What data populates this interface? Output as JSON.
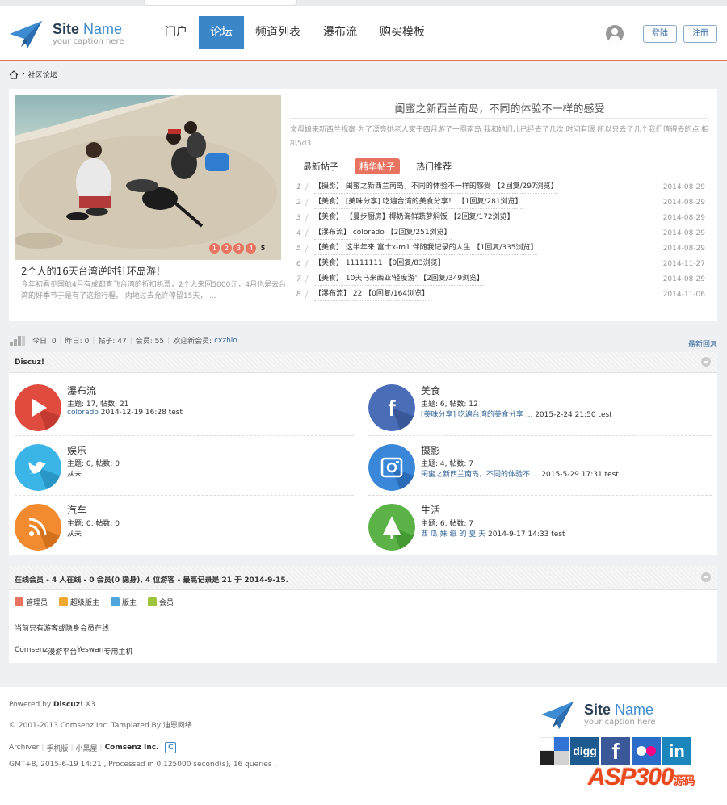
{
  "header": {
    "logo_title_a": "Site",
    "logo_title_b": " Name",
    "logo_caption": "your caption here",
    "nav": [
      "门户",
      "论坛",
      "频道列表",
      "瀑布流",
      "购买模板"
    ],
    "active_nav": "论坛",
    "login_label": "登陆",
    "register_label": "注册"
  },
  "breadcrumb": {
    "label": "社区论坛"
  },
  "feature": {
    "slide_title": "2个人的16天台湾逆时针环岛游！",
    "slide_desc": "今年初看见国航4月有成都直飞台湾的折扣机票，2个人来回5000元，4月也是去台湾的好季节于是有了这趟行程。 内地过去允许停留15天， ...",
    "slide_dots": [
      "1",
      "2",
      "3",
      "4",
      "5"
    ],
    "article_title": "闺蜜之新西兰南岛，不同的体验不一样的感受",
    "article_desc": "文母娘来新西兰视察 为了漂亮她老人家于四月游了一圈南岛 我和她们儿已经去了几次 时间有限 所以只去了几个我们值得去的点 相机5d3 ...",
    "tabs": [
      "最新帖子",
      "精华帖子",
      "热门推荐"
    ],
    "active_tab": "精华帖子",
    "posts": [
      {
        "num": "1",
        "text": "【摄影】 闺蜜之新西兰南岛，不同的体验不一样的感受 【2回复/297浏览】",
        "date": "2014-08-29"
      },
      {
        "num": "2",
        "text": "【美食】 [美味分享] 吃遍台湾的美食分享！ 【1回复/281浏览】",
        "date": "2014-08-29"
      },
      {
        "num": "3",
        "text": "【美食】 【曼步厨房】椰奶海鲜蔬萝焖饭 【2回复/172浏览】",
        "date": "2014-08-29"
      },
      {
        "num": "4",
        "text": "【瀑布流】 colorado 【2回复/251浏览】",
        "date": "2014-08-29"
      },
      {
        "num": "5",
        "text": "【美食】 这半年来 富士x-m1 伴随我记录的人生 【1回复/335浏览】",
        "date": "2014-08-29"
      },
      {
        "num": "6",
        "text": "【美食】 11111111 【0回复/83浏览】",
        "date": "2014-11-27"
      },
      {
        "num": "7",
        "text": "【美食】 10天马来西亚'轻度游' 【2回复/349浏览】",
        "date": "2014-08-29"
      },
      {
        "num": "8",
        "text": "【瀑布流】 22 【0回复/164浏览】",
        "date": "2014-11-06"
      }
    ]
  },
  "stats": {
    "today": "今日: 0",
    "yesterday": "昨日: 0",
    "posts": "帖子: 47",
    "members": "会员: 55",
    "welcome": "欢迎新会员:",
    "new_member": "cxzhio",
    "new_reply": "最新回复"
  },
  "forum_group": {
    "title": "Discuz!",
    "forums": [
      {
        "name": "瀑布流",
        "counts": "主题: 17, 帖数: 21",
        "last_link": "colorado",
        "last_rest": " 2014-12-19 16:28 test",
        "icon": "play-icon",
        "color": "#e04b3f"
      },
      {
        "name": "美食",
        "counts": "主题: 6, 帖数: 12",
        "last_link": "[美味分享] 吃遍台湾的美食分享 ...",
        "last_rest": " 2015-2-24 21:50 test",
        "icon": "facebook-icon",
        "color": "#4a6db8"
      },
      {
        "name": "娱乐",
        "counts": "主题: 0, 帖数: 0",
        "last_link": "",
        "last_rest": "从未",
        "icon": "twitter-icon",
        "color": "#3bb4e8"
      },
      {
        "name": "摄影",
        "counts": "主题: 4, 帖数: 7",
        "last_link": "闺蜜之新西兰南岛，不同的体验不 ...",
        "last_rest": " 2015-5-29 17:31 test",
        "icon": "camera-icon",
        "color": "#3a86d8"
      },
      {
        "name": "汽车",
        "counts": "主题: 0, 帖数: 0",
        "last_link": "",
        "last_rest": "从未",
        "icon": "rss-icon",
        "color": "#f28a30"
      },
      {
        "name": "生活",
        "counts": "主题: 6, 帖数: 7",
        "last_link": "西 瓜 妹 纸 的 夏 天",
        "last_rest": " 2014-9-17 14:33 test",
        "icon": "tree-icon",
        "color": "#5bb348"
      }
    ]
  },
  "online": {
    "title": "在线会员 - 4 人在线 - 0 会员(0 隐身), 4 位游客 - 最高记录是 21 于 2014-9-15.",
    "legend": [
      {
        "label": "管理员",
        "color": "#e87361"
      },
      {
        "label": "超级版主",
        "color": "#f0a830"
      },
      {
        "label": "版主",
        "color": "#4ea6dd"
      },
      {
        "label": "会员",
        "color": "#9dc43a"
      }
    ],
    "note": "当前只有游客或隐身会员在线",
    "friends": [
      "Comsenz",
      "漫游平台",
      "Yeswan",
      "专用主机"
    ]
  },
  "footer": {
    "powered_prefix": "Powered by",
    "powered_name": "Discuz!",
    "powered_ver": " X3",
    "copyright": "© 2001-2013 Comsenz Inc.  Tamplated By 迪恩网络",
    "links": [
      "Archiver",
      "手机版",
      "小黑屋"
    ],
    "company": "Comsenz Inc.",
    "gmt": "GMT+8, 2015-6-19 14:21 , Processed in 0.125000 second(s), 16 queries .",
    "social": [
      "delicious-icon",
      "digg-icon",
      "facebook-icon",
      "flickr-icon",
      "linkedin-icon"
    ],
    "social_digg": "digg",
    "social_fb": "f",
    "social_in": "in",
    "watermark": "ASP300",
    "watermark_small": "源码"
  }
}
